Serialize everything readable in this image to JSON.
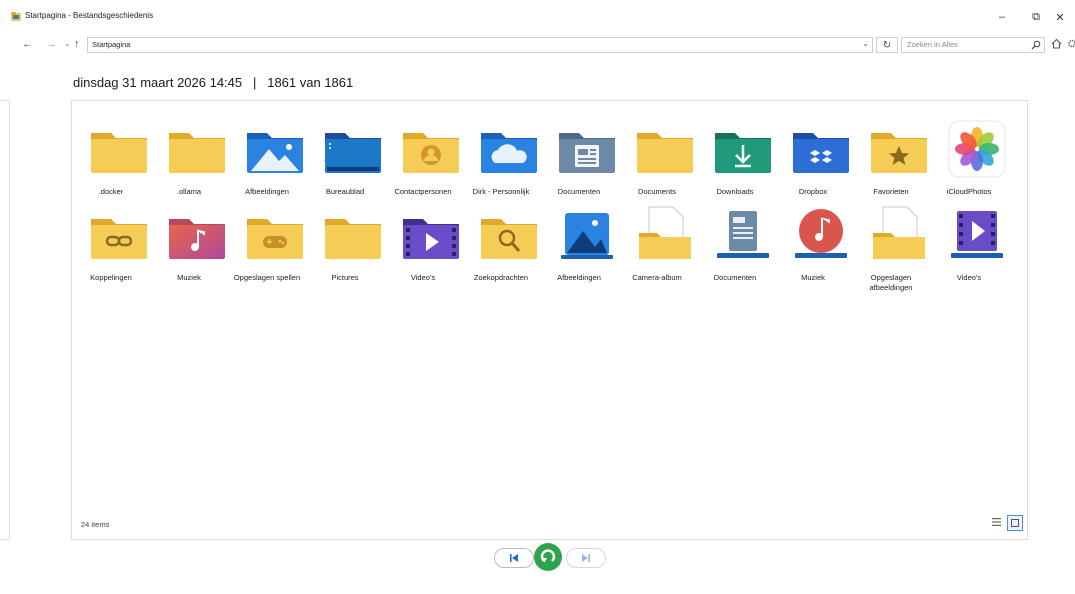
{
  "window": {
    "title": "Startpagina - Bestandsgeschiedenis",
    "controls": {
      "minimize": "–",
      "restore": "⧉",
      "close": "✕"
    }
  },
  "navigation": {
    "back": "←",
    "forward": "→",
    "recent": "⌄",
    "up": "↑",
    "address": "Startpagina",
    "address_dropdown": "⌄",
    "refresh": "↻",
    "search_placeholder": "Zoeken in Alles"
  },
  "header": {
    "date": "dinsdag 31 maart 2026 14:45",
    "separator": "|",
    "version": "1861 van 1861"
  },
  "items": [
    {
      "label": ".docker",
      "icon": "folder-icon"
    },
    {
      "label": ".ollama",
      "icon": "folder-icon"
    },
    {
      "label": "Afbeeldingen",
      "icon": "pictures-folder-icon"
    },
    {
      "label": "Bureaublad",
      "icon": "desktop-folder-icon"
    },
    {
      "label": "Contactpersonen",
      "icon": "contacts-folder-icon"
    },
    {
      "label": "Dirk - Persoonlijk",
      "icon": "onedrive-folder-icon"
    },
    {
      "label": "Documenten",
      "icon": "documents-folder-icon"
    },
    {
      "label": "Documents",
      "icon": "folder-icon"
    },
    {
      "label": "Downloads",
      "icon": "downloads-folder-icon"
    },
    {
      "label": "Dropbox",
      "icon": "dropbox-folder-icon"
    },
    {
      "label": "Favorieten",
      "icon": "favorites-folder-icon"
    },
    {
      "label": "iCloudPhotos",
      "icon": "icloud-photos-icon"
    },
    {
      "label": "Koppelingen",
      "icon": "links-folder-icon"
    },
    {
      "label": "Muziek",
      "icon": "music-folder-icon"
    },
    {
      "label": "Opgeslagen spellen",
      "icon": "saved-games-folder-icon"
    },
    {
      "label": "Pictures",
      "icon": "folder-icon"
    },
    {
      "label": "Video's",
      "icon": "videos-folder-icon"
    },
    {
      "label": "Zoekopdrachten",
      "icon": "searches-folder-icon"
    },
    {
      "label": "Afbeeldingen",
      "icon": "pictures-library-icon"
    },
    {
      "label": "Camera-album",
      "icon": "camera-roll-icon"
    },
    {
      "label": "Documenten",
      "icon": "documents-library-icon"
    },
    {
      "label": "Muziek",
      "icon": "music-library-icon"
    },
    {
      "label": "Opgeslagen afbeeldingen",
      "icon": "saved-pictures-icon"
    },
    {
      "label": "Video's",
      "icon": "videos-library-icon"
    }
  ],
  "status": {
    "count": "24 items"
  },
  "colors": {
    "folder": "#f2c54b",
    "folder_dark": "#e0a92a",
    "accent_green": "#2fa44f",
    "accent_blue": "#1e6fd0"
  }
}
